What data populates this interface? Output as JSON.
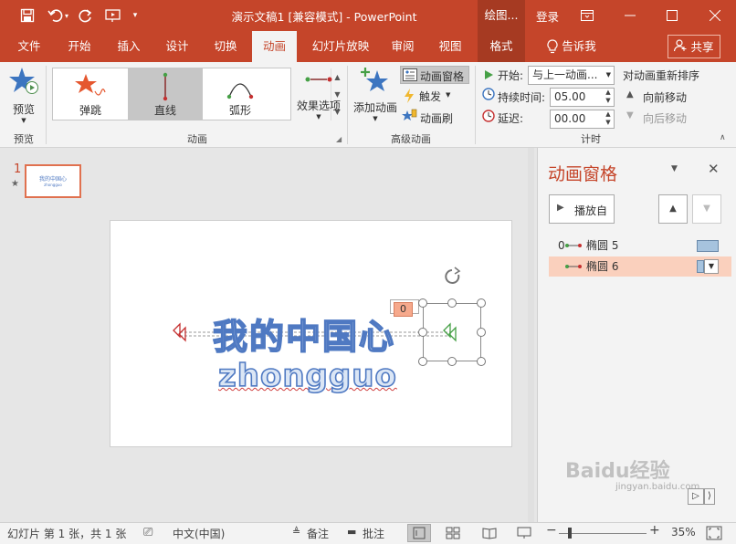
{
  "titlebar": {
    "title": "演示文稿1 [兼容模式] - PowerPoint",
    "context_group": "绘图...",
    "login": "登录"
  },
  "tabs": {
    "file": "文件",
    "home": "开始",
    "insert": "插入",
    "design": "设计",
    "transitions": "切换",
    "animations": "动画",
    "slideshow": "幻灯片放映",
    "review": "审阅",
    "view": "视图",
    "format": "格式",
    "tellme": "告诉我",
    "share": "共享"
  },
  "ribbon": {
    "preview": {
      "button": "预览",
      "group": "预览"
    },
    "animation": {
      "items": [
        "弹跳",
        "直线",
        "弧形"
      ],
      "effect_options": "效果选项",
      "group": "动画"
    },
    "advanced": {
      "add_animation": "添加动画",
      "pane": "动画窗格",
      "trigger": "触发",
      "painter": "动画刷",
      "group": "高级动画"
    },
    "timing": {
      "start_label": "开始:",
      "start_value": "与上一动画...",
      "duration_label": "持续时间:",
      "duration_value": "05.00",
      "delay_label": "延迟:",
      "delay_value": "00.00",
      "group": "计时"
    },
    "reorder": {
      "title": "对动画重新排序",
      "forward": "向前移动",
      "backward": "向后移动"
    }
  },
  "thumbnails": [
    {
      "number": "1",
      "star": "★"
    }
  ],
  "slide": {
    "heading": "我的中国心",
    "subheading": "zhongguo",
    "tag": "0"
  },
  "pane": {
    "title": "动画窗格",
    "play_from": "播放自",
    "items": [
      {
        "index": "0",
        "name": "椭圆 5"
      },
      {
        "index": "",
        "name": "椭圆 6"
      }
    ]
  },
  "status": {
    "slide_info": "幻灯片 第 1 张，共 1 张",
    "language": "中文(中国)",
    "notes": "备注",
    "comments": "批注",
    "zoom": "35%"
  },
  "watermark": {
    "brand": "Baidu经验",
    "url": "jingyan.baidu.com"
  },
  "colors": {
    "accent": "#c5452a",
    "ribbon": "#f3f3f3",
    "highlight": "#fad0bd",
    "wordart_fill": "#dbe6f5",
    "wordart_stroke": "#4f79c2"
  }
}
